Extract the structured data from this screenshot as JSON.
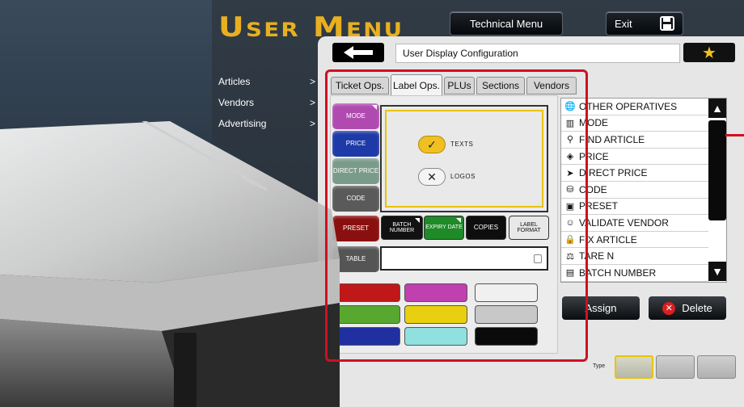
{
  "header": {
    "title": "User Menu",
    "technical_menu": "Technical Menu",
    "exit": "Exit"
  },
  "sidebar": {
    "items": [
      {
        "label": "Articles",
        "arrow": ">"
      },
      {
        "label": "Vendors",
        "arrow": ">"
      },
      {
        "label": "Advertising",
        "arrow": ">"
      }
    ]
  },
  "panel": {
    "breadcrumb": "User Display Configuration",
    "tabs": [
      "Ticket Ops.",
      "Label Ops.",
      "PLUs",
      "Sections",
      "Vendors"
    ],
    "active_tab": "Label Ops."
  },
  "operations": {
    "left_buttons": [
      {
        "label": "MODE",
        "color": "#b04ab0"
      },
      {
        "label": "PRICE",
        "color": "#1e3aa8"
      },
      {
        "label": "DIRECT PRICE",
        "color": "#7a9a8a"
      },
      {
        "label": "CODE",
        "color": "#5a5a5a"
      },
      {
        "label": "PRESET",
        "color": "#8a1010"
      },
      {
        "label": "TABLE",
        "color": "#555555"
      }
    ],
    "format_buttons": [
      {
        "label": "BATCH NUMBER",
        "bg": "#111111",
        "fg": "#ffffff"
      },
      {
        "label": "EXPIRY DATE",
        "bg": "#1e8a28",
        "fg": "#ffffff"
      },
      {
        "label": "COPIES",
        "bg": "#0e0e0e",
        "fg": "#ffffff"
      },
      {
        "label": "LABEL FORMAT",
        "bg": "#e8e8e8",
        "fg": "#111111"
      }
    ],
    "preview": {
      "texts_label": "TEXTS",
      "logos_label": "LOGOS"
    },
    "swatches": [
      "#c01818",
      "#c040b0",
      "#f0f0f0",
      "#58a830",
      "#e8d010",
      "#c8c8c8",
      "#2030a0",
      "#90e0e0",
      "#0a0a0a"
    ]
  },
  "list": {
    "items": [
      {
        "label": "OTHER OPERATIVES",
        "icon": "globe-icon"
      },
      {
        "label": "MODE",
        "icon": "mode-icon"
      },
      {
        "label": "FIND ARTICLE",
        "icon": "magnifier-icon"
      },
      {
        "label": "PRICE",
        "icon": "price-icon"
      },
      {
        "label": "DIRECT PRICE",
        "icon": "direct-price-icon"
      },
      {
        "label": "CODE",
        "icon": "basket-icon"
      },
      {
        "label": "PRESET",
        "icon": "preset-icon"
      },
      {
        "label": "VALIDATE VENDOR",
        "icon": "vendor-icon"
      },
      {
        "label": "FIX ARTICLE",
        "icon": "lock-icon"
      },
      {
        "label": "TARE N",
        "icon": "scale-icon"
      },
      {
        "label": "BATCH NUMBER",
        "icon": "batch-icon"
      }
    ]
  },
  "actions": {
    "assign": "Assign",
    "delete": "Delete"
  },
  "type": {
    "label": "Type"
  }
}
